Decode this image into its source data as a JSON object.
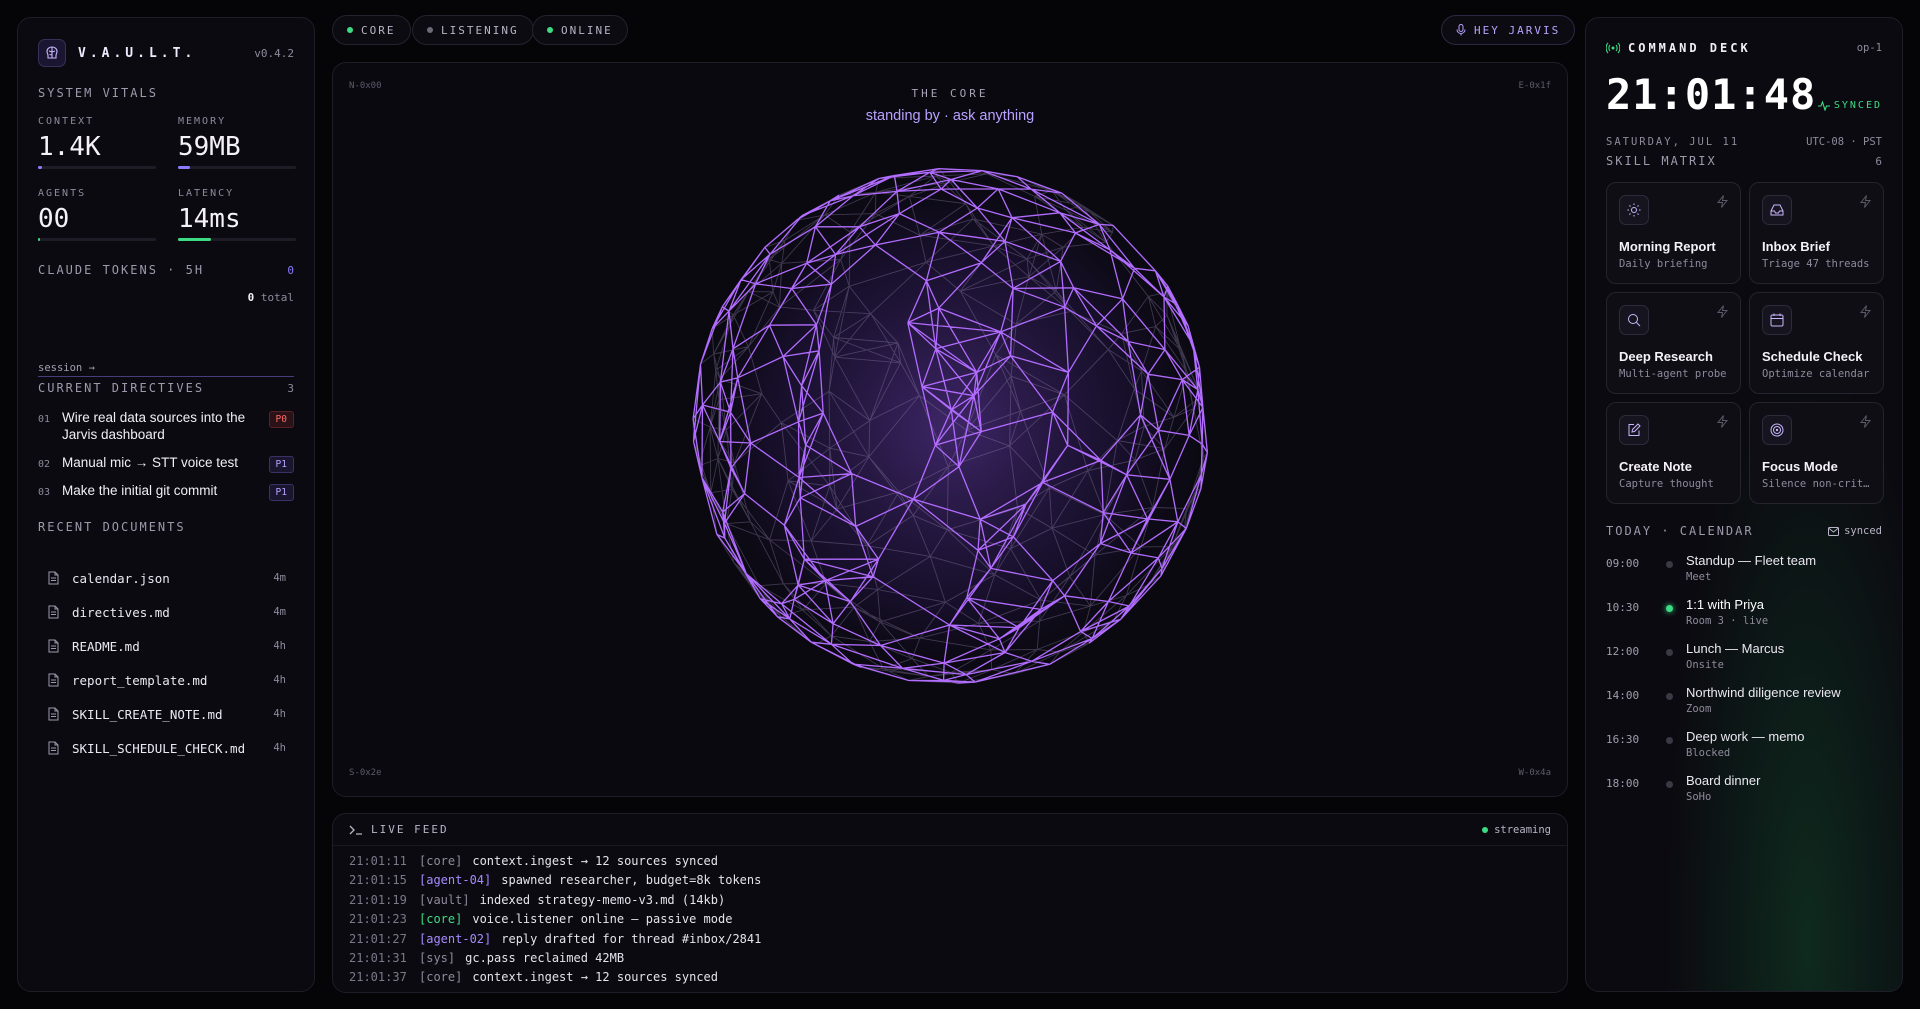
{
  "colors": {
    "accent": "#b49bff",
    "green": "#3ddc84",
    "p0": "#ff6b6b",
    "sphere": "#b26cff"
  },
  "brand": {
    "name": "V.A.U.L.T.",
    "version": "v0.4.2",
    "icon": "brain-icon"
  },
  "vitals": {
    "title": "SYSTEM VITALS",
    "items": [
      {
        "label": "CONTEXT",
        "value": "1.4K",
        "level": 0.03,
        "color": "#8b7bff"
      },
      {
        "label": "MEMORY",
        "value": "59MB",
        "level": 0.1,
        "color": "#8b7bff"
      },
      {
        "label": "AGENTS",
        "value": "00",
        "level": 0.02,
        "color": "#3ddc84"
      },
      {
        "label": "LATENCY",
        "value": "14ms",
        "level": 0.28,
        "color": "#3ddc84"
      }
    ]
  },
  "tokens": {
    "title": "CLAUDE TOKENS · 5H",
    "count": "0",
    "total": "0",
    "total_suffix": " total",
    "session_link": "session →"
  },
  "directives": {
    "title": "CURRENT DIRECTIVES",
    "count": "3",
    "items": [
      {
        "num": "01",
        "text": "Wire real data sources into the Jarvis dashboard",
        "priority": "P0"
      },
      {
        "num": "02",
        "text": "Manual mic → STT voice test",
        "priority": "P1"
      },
      {
        "num": "03",
        "text": "Make the initial git commit",
        "priority": "P1"
      }
    ]
  },
  "documents": {
    "title": "RECENT DOCUMENTS",
    "items": [
      {
        "name": "calendar.json",
        "age": "4m"
      },
      {
        "name": "directives.md",
        "age": "4m"
      },
      {
        "name": "README.md",
        "age": "4h"
      },
      {
        "name": "report_template.md",
        "age": "4h"
      },
      {
        "name": "SKILL_CREATE_NOTE.md",
        "age": "4h"
      },
      {
        "name": "SKILL_SCHEDULE_CHECK.md",
        "age": "4h"
      }
    ]
  },
  "status_pills": [
    {
      "label": "CORE",
      "dot": "#3ddc84"
    },
    {
      "label": "LISTENING",
      "dot": "#6e6a78"
    },
    {
      "label": "ONLINE",
      "dot": "#3ddc84"
    }
  ],
  "wake": {
    "label": "HEY JARVIS",
    "icon": "mic-icon"
  },
  "core": {
    "title": "THE CORE",
    "subtitle": "standing by · ask anything",
    "corners": {
      "nw": "N-0x00",
      "ne": "E-0x1f",
      "sw": "S-0x2e",
      "se": "W-0x4a"
    }
  },
  "feed": {
    "title": "LIVE FEED",
    "status": "streaming",
    "lines": [
      {
        "time": "21:01:11",
        "src": "[core]",
        "src_color": "#8f8a9c",
        "msg": "context.ingest → 12 sources synced"
      },
      {
        "time": "21:01:15",
        "src": "[agent-04]",
        "src_color": "#a58bff",
        "msg": "spawned researcher, budget=8k tokens"
      },
      {
        "time": "21:01:19",
        "src": "[vault]",
        "src_color": "#8f8a9c",
        "msg": "indexed strategy-memo-v3.md (14kb)"
      },
      {
        "time": "21:01:23",
        "src": "[core]",
        "src_color": "#3ddc84",
        "msg": "voice.listener online — passive mode"
      },
      {
        "time": "21:01:27",
        "src": "[agent-02]",
        "src_color": "#a58bff",
        "msg": "reply drafted for thread #inbox/2841"
      },
      {
        "time": "21:01:31",
        "src": "[sys]",
        "src_color": "#8f8a9c",
        "msg": "gc.pass reclaimed 42MB"
      },
      {
        "time": "21:01:37",
        "src": "[core]",
        "src_color": "#8f8a9c",
        "msg": "context.ingest → 12 sources synced"
      }
    ]
  },
  "deck": {
    "title": "COMMAND DECK",
    "op": "op-1",
    "time": "21:01:48",
    "synced": "SYNCED",
    "date": "SATURDAY, JUL 11",
    "tz": "UTC-08 · PST"
  },
  "skills": {
    "title": "SKILL MATRIX",
    "count": "6",
    "items": [
      {
        "name": "Morning Report",
        "desc": "Daily briefing",
        "icon": "sun-icon"
      },
      {
        "name": "Inbox Brief",
        "desc": "Triage 47 threads",
        "icon": "inbox-icon"
      },
      {
        "name": "Deep Research",
        "desc": "Multi-agent probe",
        "icon": "search-icon"
      },
      {
        "name": "Schedule Check",
        "desc": "Optimize calendar",
        "icon": "calendar-icon"
      },
      {
        "name": "Create Note",
        "desc": "Capture thought",
        "icon": "edit-icon"
      },
      {
        "name": "Focus Mode",
        "desc": "Silence non-criti…",
        "icon": "target-icon"
      }
    ]
  },
  "calendar": {
    "title": "TODAY · CALENDAR",
    "status": "synced",
    "events": [
      {
        "time": "09:00",
        "title": "Standup — Fleet team",
        "sub": "Meet",
        "live": false
      },
      {
        "time": "10:30",
        "title": "1:1 with Priya",
        "sub": "Room 3 · live",
        "live": true
      },
      {
        "time": "12:00",
        "title": "Lunch — Marcus",
        "sub": "Onsite",
        "live": false
      },
      {
        "time": "14:00",
        "title": "Northwind diligence review",
        "sub": "Zoom",
        "live": false
      },
      {
        "time": "16:30",
        "title": "Deep work — memo",
        "sub": "Blocked",
        "live": false
      },
      {
        "time": "18:00",
        "title": "Board dinner",
        "sub": "SoHo",
        "live": false
      }
    ]
  }
}
